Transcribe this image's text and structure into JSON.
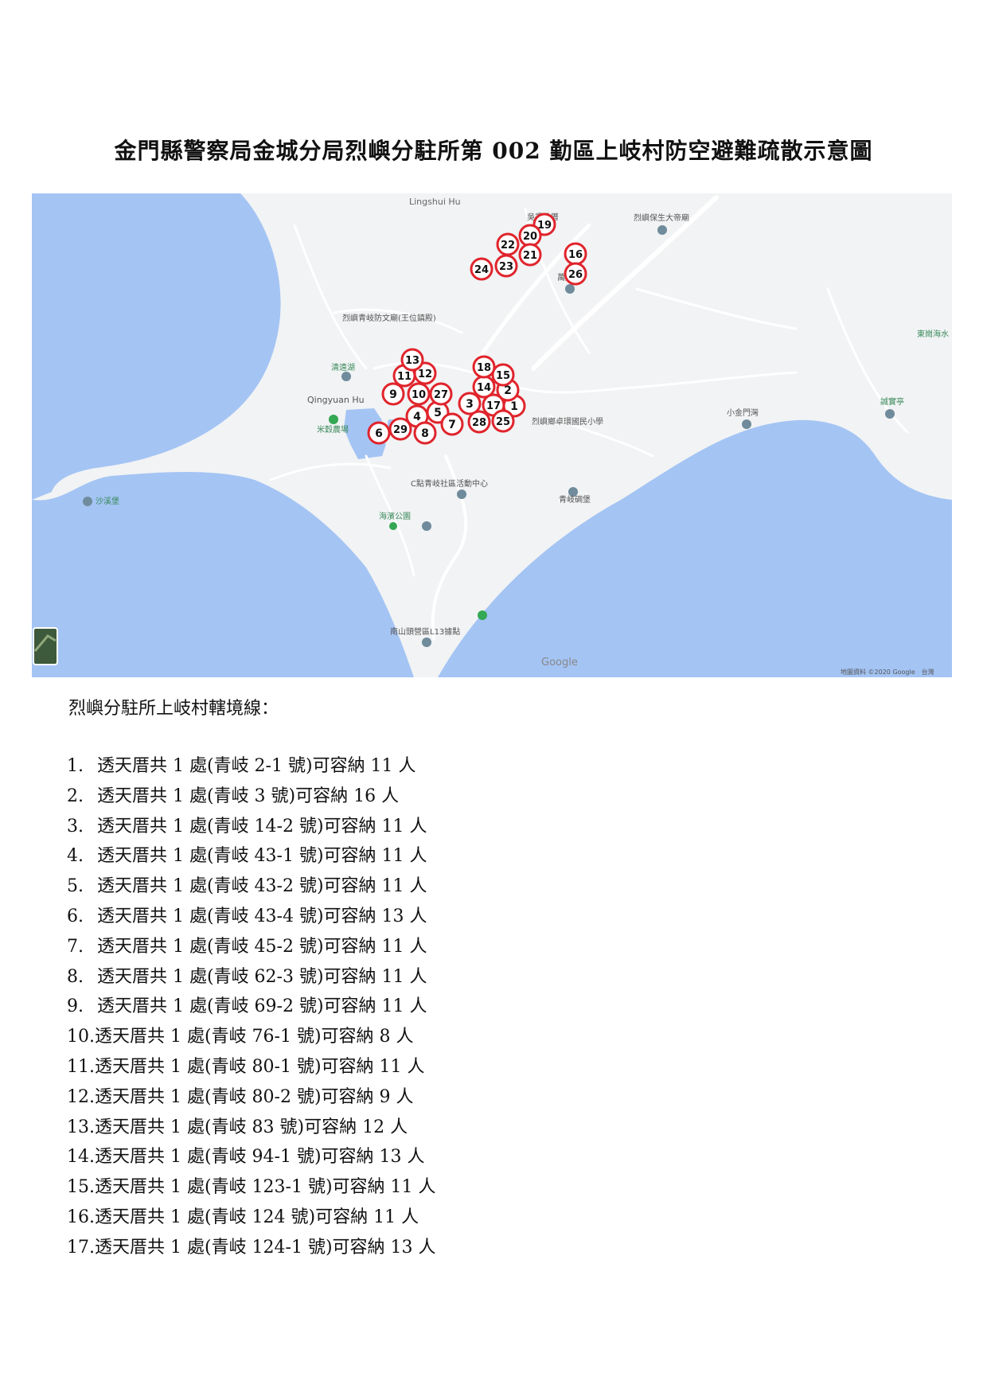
{
  "document": {
    "title": "金門縣警察局金城分局烈嶼分駐所第 002 勤區上岐村防空避難疏散示意圖",
    "intro": "烈嶼分駐所上岐村轄境線："
  },
  "map": {
    "colors": {
      "water": "#a4c4f4",
      "land": "#f1f3f4",
      "road": "#ffffff",
      "marker": "#e0242c",
      "poi": "#6f8b9c",
      "park": "#34a853"
    },
    "place_labels": {
      "lingshui": "Lingshui Hu",
      "qingyuan": "Qingyuan Hu",
      "shaxi": "沙溪堡",
      "haibin": "海濱公園",
      "community": "C點青岐社區活動中心",
      "qingqi_fort": "青岐碉堡",
      "xiaojinmen": "小金門灣",
      "south_hill": "南山頭營區L13據點",
      "paradise": "東崗海水",
      "rock": "誠實亭",
      "temple_top": "吳秀才厝",
      "road_right": "烈嶼保生大帝廟",
      "wangye": "萬聖宮",
      "wang_temple": "烈嶼青岐防文廟(王位鎮殿)",
      "qingyuan_lake_poi": "清遠湖",
      "rice_field": "米穀農場",
      "school": "烈嶼鄉卓環國民小學",
      "google": "Google",
      "copyright": "地圖資料 ©2020 Google　台灣"
    },
    "markers": [
      "1",
      "2",
      "3",
      "4",
      "5",
      "6",
      "7",
      "8",
      "9",
      "10",
      "11",
      "12",
      "13",
      "14",
      "15",
      "16",
      "17",
      "18",
      "19",
      "20",
      "21",
      "22",
      "23",
      "24",
      "25",
      "26",
      "27",
      "28",
      "29"
    ],
    "icons": [
      "pin-icon",
      "park-icon",
      "satellite-thumbnail-icon"
    ]
  },
  "shelters": [
    {
      "num": "1.",
      "text": "透天厝共 1 處(青岐 2-1 號)可容納 11 人"
    },
    {
      "num": "2.",
      "text": "透天厝共 1 處(青岐 3 號)可容納 16 人"
    },
    {
      "num": "3.",
      "text": "透天厝共 1 處(青岐 14-2 號)可容納 11 人"
    },
    {
      "num": "4.",
      "text": "透天厝共 1 處(青岐 43-1 號)可容納 11 人"
    },
    {
      "num": "5.",
      "text": "透天厝共 1 處(青岐 43-2 號)可容納 11 人"
    },
    {
      "num": "6.",
      "text": "透天厝共 1 處(青岐 43-4 號)可容納 13 人"
    },
    {
      "num": "7.",
      "text": "透天厝共 1 處(青岐 45-2 號)可容納 11 人"
    },
    {
      "num": "8.",
      "text": "透天厝共 1 處(青岐 62-3 號)可容納 11 人"
    },
    {
      "num": "9.",
      "text": "透天厝共 1 處(青岐 69-2 號)可容納 11 人"
    },
    {
      "num": "10.",
      "text": "透天厝共 1 處(青岐 76-1 號)可容納 8 人"
    },
    {
      "num": "11.",
      "text": "透天厝共 1 處(青岐 80-1 號)可容納 11 人"
    },
    {
      "num": "12.",
      "text": "透天厝共 1 處(青岐 80-2 號)可容納 9 人"
    },
    {
      "num": "13.",
      "text": "透天厝共 1 處(青岐 83 號)可容納 12 人"
    },
    {
      "num": "14.",
      "text": "透天厝共 1 處(青岐 94-1 號)可容納 13 人"
    },
    {
      "num": "15.",
      "text": "透天厝共 1 處(青岐 123-1 號)可容納 11 人"
    },
    {
      "num": "16.",
      "text": "透天厝共 1 處(青岐 124 號)可容納 11 人"
    },
    {
      "num": "17.",
      "text": "透天厝共 1 處(青岐 124-1 號)可容納 13 人"
    }
  ]
}
